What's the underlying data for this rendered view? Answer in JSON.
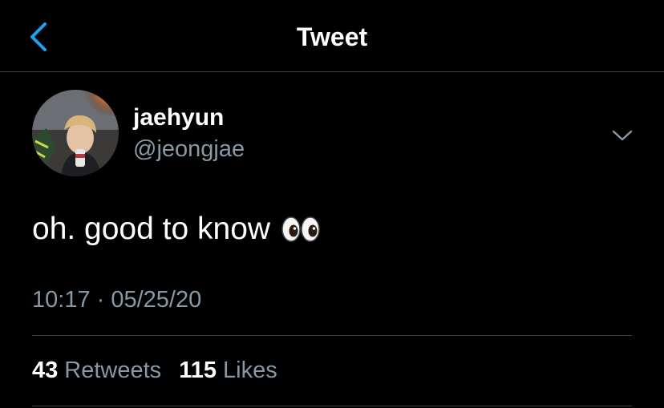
{
  "nav": {
    "back_icon": "chevron-left-icon",
    "title": "Tweet"
  },
  "tweet": {
    "author": {
      "display_name": "jaehyun",
      "handle": "@jeongjae",
      "avatar_icon": "profile-photo"
    },
    "menu_icon": "chevron-down-icon",
    "text": "oh. good to know",
    "emoji": "eyes-emoji",
    "timestamp": "10:17 · 05/25/20",
    "retweets": {
      "count": "43",
      "label": "Retweets"
    },
    "likes": {
      "count": "115",
      "label": "Likes"
    }
  },
  "colors": {
    "background": "#000000",
    "text_primary": "#ffffff",
    "text_secondary": "#8899a6",
    "accent": "#1da1f2",
    "divider": "#38444d"
  }
}
